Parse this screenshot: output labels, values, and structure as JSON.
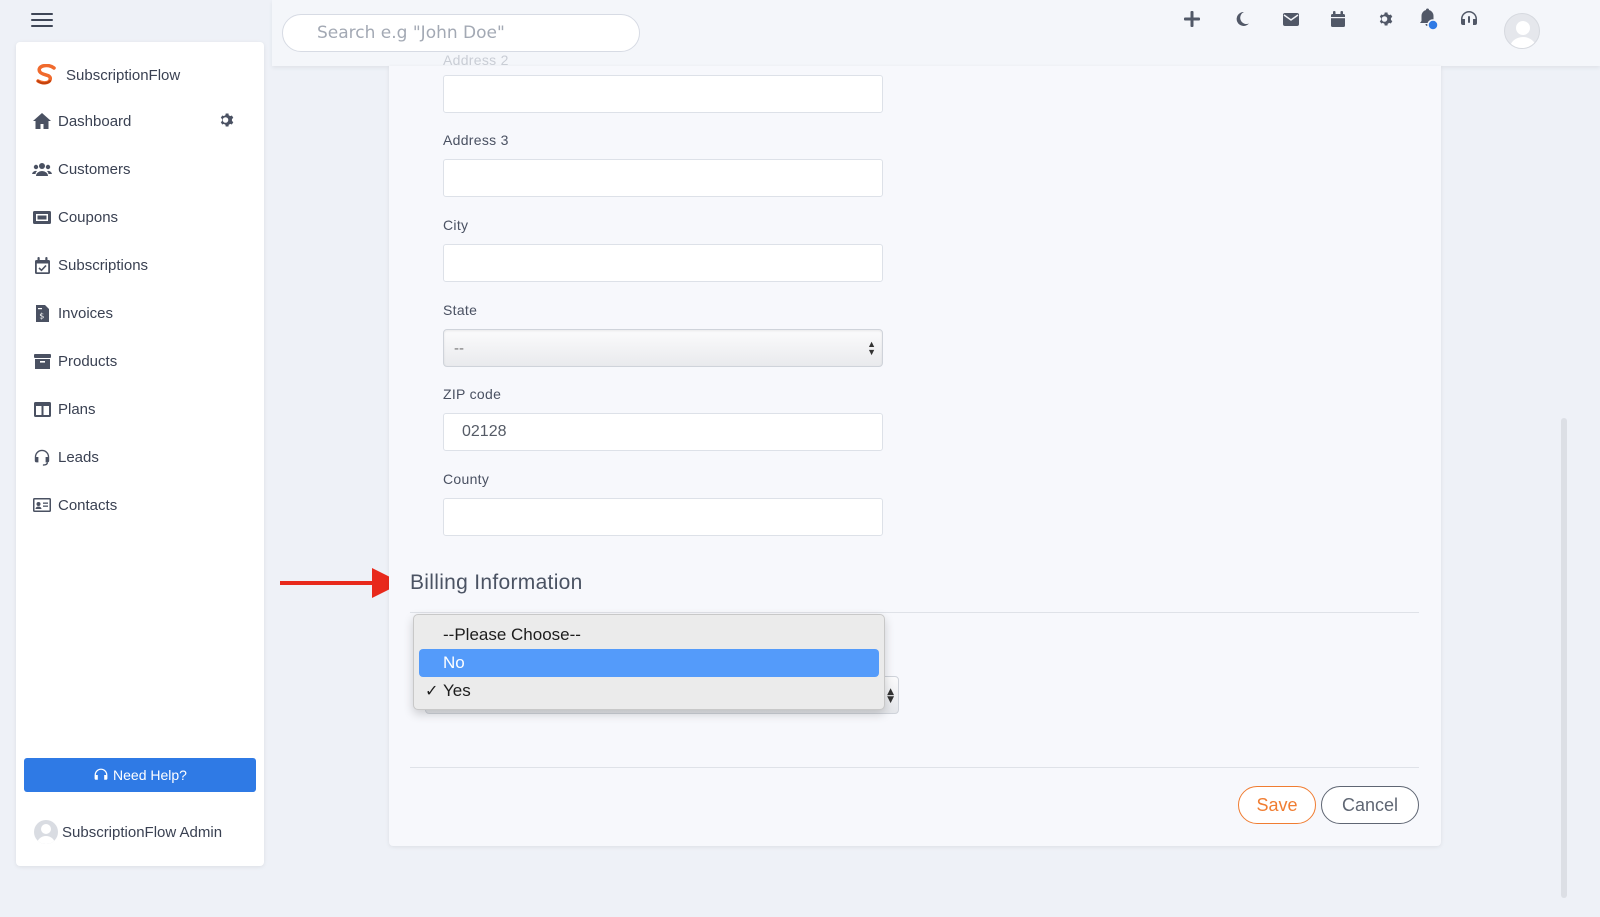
{
  "topbar": {
    "search_placeholder": "Search e.g \"John Doe\"",
    "icons": [
      "plus-icon",
      "moon-icon",
      "mail-icon",
      "calendar-icon",
      "gear-icon",
      "bell-icon",
      "headset-icon",
      "user-avatar"
    ],
    "notification_dot_color": "#2f7ae5"
  },
  "sidebar": {
    "brand": "SubscriptionFlow",
    "brand_color": "#f06a2d",
    "items": [
      {
        "label": "Dashboard",
        "icon": "home-icon"
      },
      {
        "label": "Customers",
        "icon": "users-icon"
      },
      {
        "label": "Coupons",
        "icon": "ticket-icon"
      },
      {
        "label": "Subscriptions",
        "icon": "calendar-check-icon"
      },
      {
        "label": "Invoices",
        "icon": "invoice-icon"
      },
      {
        "label": "Products",
        "icon": "archive-icon"
      },
      {
        "label": "Plans",
        "icon": "columns-icon"
      },
      {
        "label": "Leads",
        "icon": "headset-icon"
      },
      {
        "label": "Contacts",
        "icon": "id-card-icon"
      }
    ],
    "need_help": "Need Help?",
    "admin_name": "SubscriptionFlow Admin"
  },
  "form": {
    "address2_label": "Address 2",
    "address3_label": "Address 3",
    "city_label": "City",
    "state_label": "State",
    "state_value": "--",
    "zip_label": "ZIP code",
    "zip_value": "02128",
    "county_label": "County",
    "billing_title": "Billing Information",
    "dropdown_options": [
      {
        "label": "--Please Choose--",
        "selected": false,
        "checked": false
      },
      {
        "label": "No",
        "selected": true,
        "checked": false
      },
      {
        "label": "Yes",
        "selected": false,
        "checked": true
      }
    ],
    "check_mark": "✓",
    "save_label": "Save",
    "cancel_label": "Cancel"
  },
  "colors": {
    "accent": "#f07d32",
    "primary": "#2f7ae5",
    "highlight": "#549bfa",
    "annotation_arrow": "#e8291c"
  }
}
